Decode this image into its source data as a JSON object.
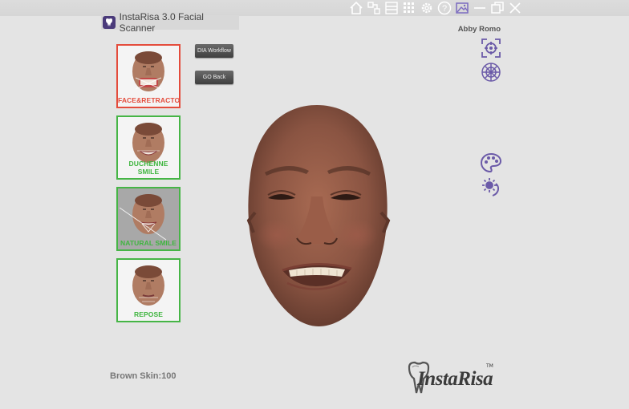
{
  "window": {
    "title": "InstaRisa 3.0 Facial Scanner",
    "controls": [
      "home-icon",
      "layout-icon",
      "panels-icon",
      "grid-icon",
      "gear-icon",
      "help-icon",
      "image-icon",
      "minimize-icon",
      "restore-icon",
      "close-icon"
    ]
  },
  "user": {
    "name": "Abby Romo"
  },
  "toolbar": {
    "workflow_label": "DIA Workflow",
    "goback_label": "GO Back"
  },
  "thumbnails": [
    {
      "label": "FACE&RETRACTORS",
      "status": "red"
    },
    {
      "label": "DUCHENNE SMILE",
      "status": "green"
    },
    {
      "label": "NATURAL SMILE",
      "status": "green",
      "selected": true
    },
    {
      "label": "REPOSE",
      "status": "green"
    }
  ],
  "right_tools": [
    "target-icon",
    "mesh-sphere-icon",
    "palette-icon",
    "light-icon"
  ],
  "skin": {
    "label": "Brown Skin:100"
  },
  "brand": {
    "name": "InstaRisa",
    "tm": "TM"
  },
  "colors": {
    "accent_purple": "#6b5aa8",
    "red": "#e44c3c",
    "green": "#46b546"
  }
}
